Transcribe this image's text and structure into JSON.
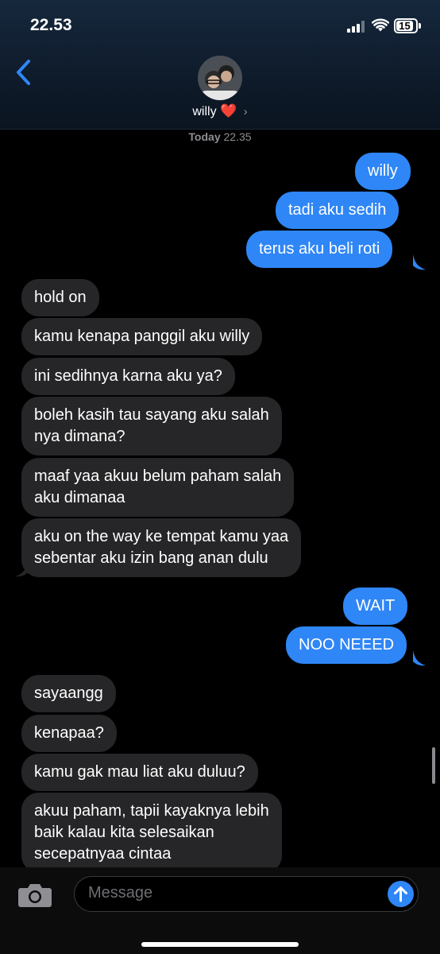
{
  "status_bar": {
    "time": "22.53",
    "battery": "15"
  },
  "contact": {
    "name": "willy",
    "heart": "❤️",
    "chevron": "›"
  },
  "thread": {
    "timestamp_day": "Today",
    "timestamp_time": "22.35"
  },
  "messages": [
    {
      "dir": "out",
      "text": "willy"
    },
    {
      "dir": "out",
      "text": "tadi aku sedih"
    },
    {
      "dir": "out",
      "text": "terus aku beli roti"
    },
    {
      "dir": "in",
      "text": "hold on"
    },
    {
      "dir": "in",
      "text": "kamu kenapa panggil aku willy"
    },
    {
      "dir": "in",
      "text": "ini sedihnya karna aku ya?"
    },
    {
      "dir": "in",
      "line1": "boleh kasih tau sayang aku salah",
      "line2": "nya dimana?"
    },
    {
      "dir": "in",
      "line1": "maaf yaa akuu belum paham salah",
      "line2": "aku dimanaa"
    },
    {
      "dir": "in",
      "line1": "aku on the way ke tempat kamu yaa",
      "line2": "sebentar aku izin bang anan dulu"
    },
    {
      "dir": "out",
      "text": "WAIT"
    },
    {
      "dir": "out",
      "text": "NOO NEEED"
    },
    {
      "dir": "in",
      "text": "sayaangg"
    },
    {
      "dir": "in",
      "text": "kenapaa?"
    },
    {
      "dir": "in",
      "text": "kamu gak mau liat aku duluu?"
    },
    {
      "dir": "in",
      "line1": "akuu paham, tapii kayaknya lebih",
      "line2": "baik kalau kita selesaikan",
      "line3": "secepatnyaa cintaa"
    }
  ],
  "composer": {
    "placeholder": "Message"
  },
  "colors": {
    "outgoing": "#2f86f6",
    "incoming": "#262628",
    "background": "#000000"
  },
  "icons": [
    "back-chevron-icon",
    "camera-icon",
    "send-arrow-icon",
    "wifi-icon",
    "signal-icon",
    "battery-icon"
  ]
}
